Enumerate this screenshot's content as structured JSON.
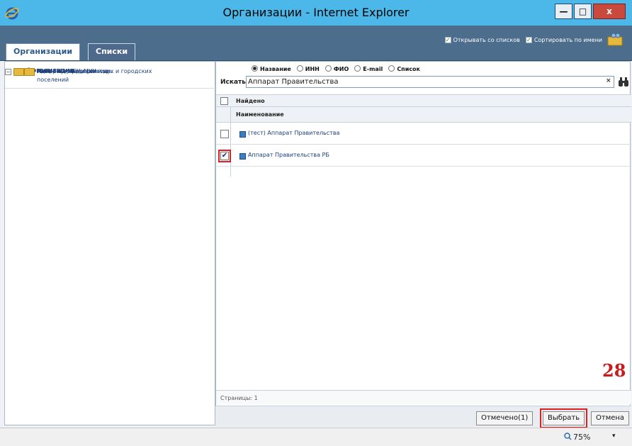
{
  "window": {
    "title": "Организации - Internet Explorer",
    "minimize_label": "—",
    "maximize_label": "□",
    "close_label": "x"
  },
  "tabs": [
    "Организации",
    "Списки"
  ],
  "options": {
    "open_from_lists": "Открывать со списков",
    "sort_by_name": "Сортировать по имени"
  },
  "tree": {
    "root": "Организации",
    "root_toggle": "−",
    "children": [
      "Администрации сельских и городских поселений",
      "Импорт",
      "Казенные предприятия",
      "МУП, ГУП, МБУ, МКУ и др.",
      "Новые организации"
    ]
  },
  "search": {
    "radios": [
      "Название",
      "ИНН",
      "ФИО",
      "E-mail",
      "Список"
    ],
    "selected_radio": "Название",
    "label": "Искать:",
    "value": "Аппарат Правительства",
    "clear_label": "×"
  },
  "grid": {
    "found_header": "Найдено",
    "column_header": "Наименование",
    "rows": [
      {
        "name": "(тест) Аппарат Правительства",
        "checked": false,
        "check_mark": ""
      },
      {
        "name": "Аппарат Правительства РБ",
        "checked": true,
        "check_mark": "✔"
      }
    ],
    "pages_label": "Страницы: 1"
  },
  "buttons": {
    "marked": "Отмечено(1)",
    "choose": "Выбрать",
    "cancel": "Отмена"
  },
  "annotation": "28",
  "status": {
    "zoom": "75%",
    "zoom_dropdown": "▾"
  },
  "colors": {
    "titlebar": "#4cb8e9",
    "toolbar": "#4c6d8c",
    "highlight": "#e02020",
    "annotation": "#c81c1c"
  }
}
